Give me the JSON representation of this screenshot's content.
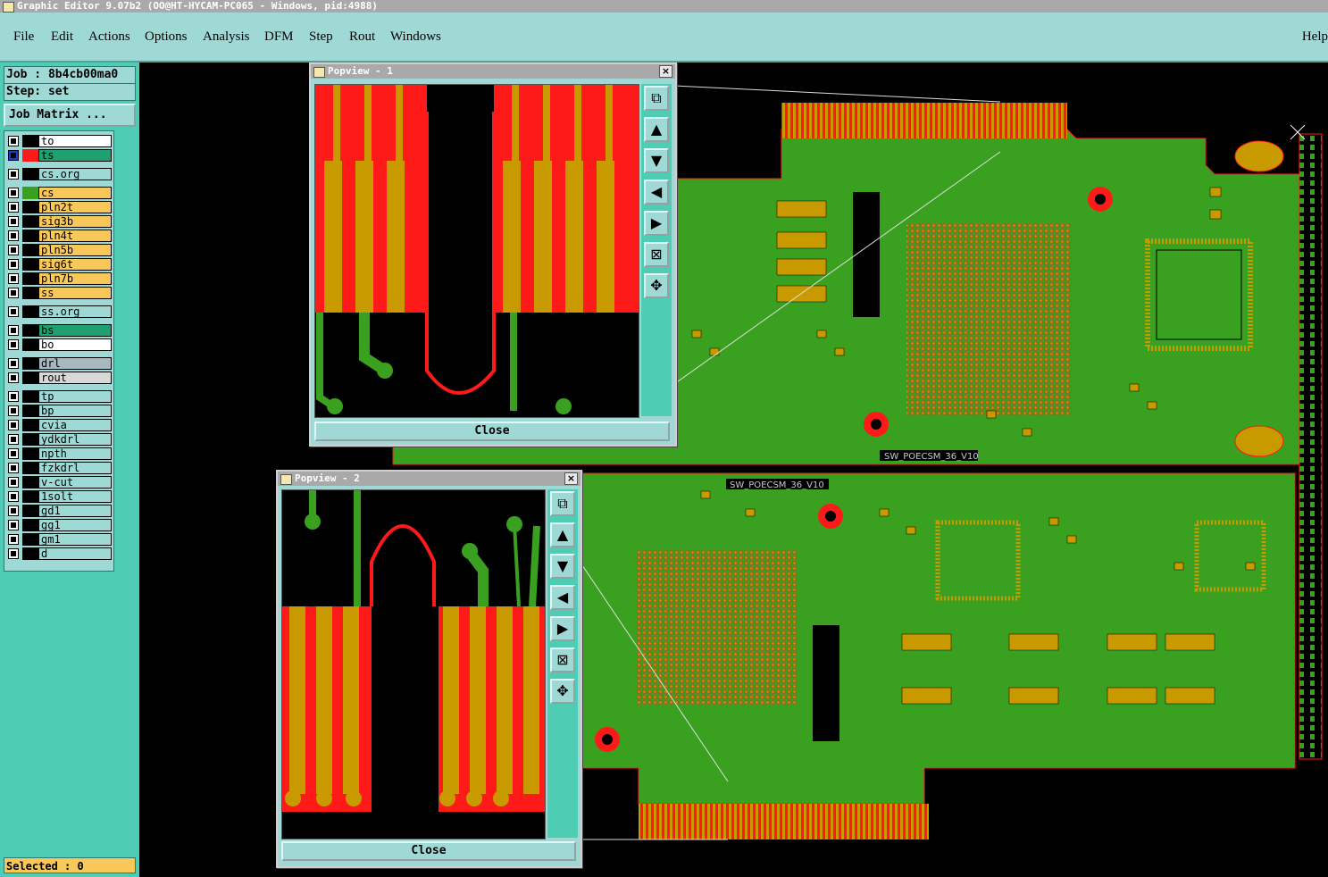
{
  "window": {
    "title": "Graphic Editor 9.07b2 (OO@HT-HYCAM-PC065 - Windows, pid:4988)"
  },
  "menu": {
    "items": [
      "File",
      "Edit",
      "Actions",
      "Options",
      "Analysis",
      "DFM",
      "Step",
      "Rout",
      "Windows"
    ],
    "help": "Help"
  },
  "job": {
    "label": "Job : 8b4cb00ma0",
    "step": "Step: set",
    "matrix_button": "Job Matrix ..."
  },
  "layers": [
    {
      "name": "to",
      "color": "#ffffff",
      "swatch": "#000000"
    },
    {
      "name": "ts",
      "color": "#20a070",
      "swatch": "#ff1a1a",
      "selected": true
    },
    {
      "name": "cs.org",
      "color": "#9fd9d6",
      "swatch": "#000000"
    },
    {
      "name": "cs",
      "color": "#f8c85a",
      "swatch": "#3aa020"
    },
    {
      "name": "pln2t",
      "color": "#f8c85a",
      "swatch": "#000000"
    },
    {
      "name": "sig3b",
      "color": "#f8c85a",
      "swatch": "#000000"
    },
    {
      "name": "pln4t",
      "color": "#f8c85a",
      "swatch": "#000000"
    },
    {
      "name": "pln5b",
      "color": "#f8c85a",
      "swatch": "#000000"
    },
    {
      "name": "sig6t",
      "color": "#f8c85a",
      "swatch": "#000000"
    },
    {
      "name": "pln7b",
      "color": "#f8c85a",
      "swatch": "#000000"
    },
    {
      "name": "ss",
      "color": "#f8c85a",
      "swatch": "#000000"
    },
    {
      "name": "ss.org",
      "color": "#9fd9d6",
      "swatch": "#000000"
    },
    {
      "name": "bs",
      "color": "#20a070",
      "swatch": "#000000"
    },
    {
      "name": "bo",
      "color": "#ffffff",
      "swatch": "#000000"
    },
    {
      "name": "drl",
      "color": "#a8b8c0",
      "swatch": "#000000"
    },
    {
      "name": "rout",
      "color": "#d8d8d8",
      "swatch": "#000000"
    },
    {
      "name": "tp",
      "color": "#9fd9d6",
      "swatch": "#000000"
    },
    {
      "name": "bp",
      "color": "#9fd9d6",
      "swatch": "#000000"
    },
    {
      "name": "cvia",
      "color": "#9fd9d6",
      "swatch": "#000000"
    },
    {
      "name": "ydkdrl",
      "color": "#9fd9d6",
      "swatch": "#000000"
    },
    {
      "name": "npth",
      "color": "#9fd9d6",
      "swatch": "#000000"
    },
    {
      "name": "fzkdrl",
      "color": "#9fd9d6",
      "swatch": "#000000"
    },
    {
      "name": "v-cut",
      "color": "#9fd9d6",
      "swatch": "#000000"
    },
    {
      "name": "1solt",
      "color": "#9fd9d6",
      "swatch": "#000000"
    },
    {
      "name": "gd1",
      "color": "#9fd9d6",
      "swatch": "#000000"
    },
    {
      "name": "gg1",
      "color": "#9fd9d6",
      "swatch": "#000000"
    },
    {
      "name": "gm1",
      "color": "#9fd9d6",
      "swatch": "#000000"
    },
    {
      "name": "d",
      "color": "#9fd9d6",
      "swatch": "#000000"
    }
  ],
  "status": {
    "selected": "Selected : 0"
  },
  "board": {
    "silk_text_top": "SW_POECSM_36_V10",
    "silk_text_bottom": "SW_POECSM_36_V10"
  },
  "popview1": {
    "title": "Popview - 1",
    "close": "Close"
  },
  "popview2": {
    "title": "Popview - 2",
    "close": "Close"
  },
  "colors": {
    "copper": "#c89a00",
    "mask": "#ff1a1a",
    "board": "#3aa020",
    "background": "#000000",
    "panel": "#9fd9d6"
  }
}
